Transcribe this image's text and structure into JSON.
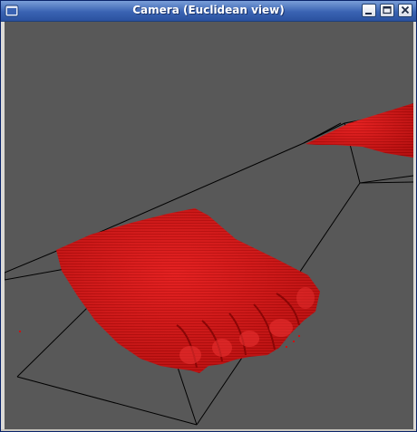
{
  "window": {
    "title": "Camera (Euclidean view)",
    "buttons": [
      "minimize-button",
      "maximize-button",
      "close-button"
    ]
  },
  "viewport": {
    "background_color": "#585858",
    "wireframe_color": "#000000",
    "model_color": "#d01010",
    "content": "3D voxel rendering"
  }
}
